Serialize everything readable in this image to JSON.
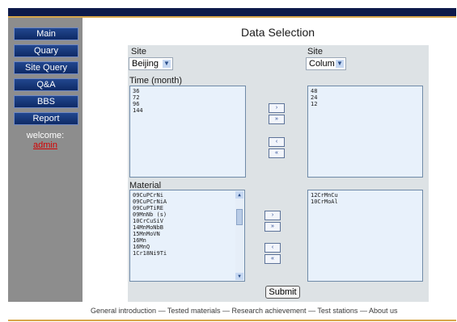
{
  "nav": {
    "items": [
      "Main",
      "Quary",
      "Site Query",
      "Q&A",
      "BBS",
      "Report"
    ],
    "welcome_label": "welcome:",
    "user": "admin"
  },
  "page": {
    "title": "Data Selection"
  },
  "form": {
    "left_site_label": "Site",
    "left_site_value": "Beijing",
    "right_site_label": "Site",
    "right_site_value": "Colum",
    "time_label": "Time (month)",
    "time_available": [
      "36",
      "72",
      "96",
      "144"
    ],
    "time_selected": [
      "48",
      "24",
      "12"
    ],
    "material_label": "Material",
    "material_available": [
      "09CuPCrNi",
      "09CuPCrNiA",
      "09CuPTiRE",
      "09MnNb (s)",
      "10CrCuSiV",
      "14MnMoNbB",
      "15MnMoVN",
      "16Mn",
      "16MnQ",
      "1Cr18Ni9Ti"
    ],
    "material_selected": [
      "12CrMnCu",
      "10CrMoAl"
    ],
    "submit_label": "Submit"
  },
  "move_buttons": {
    "add": "›",
    "add_all": "»",
    "remove": "‹",
    "remove_all": "«"
  },
  "icons": {
    "dropdown": "chevron-down-icon",
    "scroll_up": "arrow-up-icon",
    "scroll_down": "arrow-down-icon"
  },
  "footer": {
    "links": [
      "General introduction",
      "Tested materials",
      "Research achievement",
      "Test stations",
      "About us"
    ],
    "separator": "—"
  },
  "colors": {
    "header_band": "#0d1a4a",
    "accent": "#d7a64a",
    "sidebar": "#8d8d8d",
    "nav_button": "#1a3a80",
    "panel": "#dde2e5",
    "listbox": "#e8f1fb",
    "user_link": "#d40000"
  }
}
